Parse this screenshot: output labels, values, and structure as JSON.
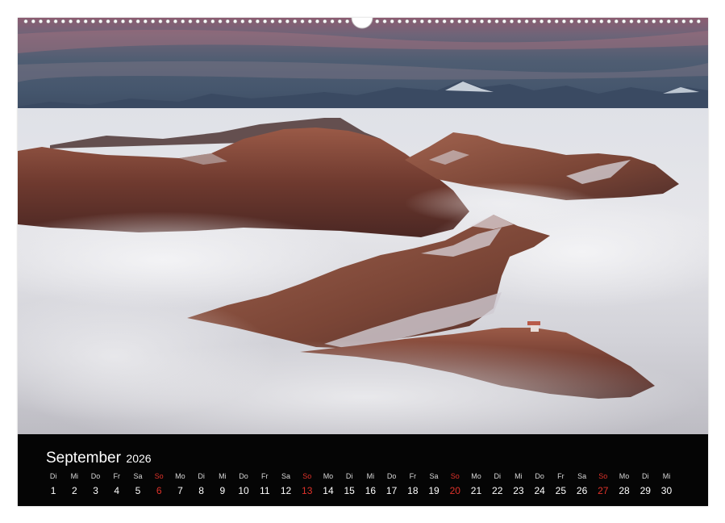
{
  "calendar": {
    "month": "September",
    "year": "2026",
    "weekend_color": "#e0322a",
    "days": [
      {
        "dow": "Di",
        "num": "1"
      },
      {
        "dow": "Mi",
        "num": "2"
      },
      {
        "dow": "Do",
        "num": "3"
      },
      {
        "dow": "Fr",
        "num": "4"
      },
      {
        "dow": "Sa",
        "num": "5"
      },
      {
        "dow": "So",
        "num": "6",
        "sunday": true
      },
      {
        "dow": "Mo",
        "num": "7"
      },
      {
        "dow": "Di",
        "num": "8"
      },
      {
        "dow": "Mi",
        "num": "9"
      },
      {
        "dow": "Do",
        "num": "10"
      },
      {
        "dow": "Fr",
        "num": "11"
      },
      {
        "dow": "Sa",
        "num": "12"
      },
      {
        "dow": "So",
        "num": "13",
        "sunday": true
      },
      {
        "dow": "Mo",
        "num": "14"
      },
      {
        "dow": "Di",
        "num": "15"
      },
      {
        "dow": "Mi",
        "num": "16"
      },
      {
        "dow": "Do",
        "num": "17"
      },
      {
        "dow": "Fr",
        "num": "18"
      },
      {
        "dow": "Sa",
        "num": "19"
      },
      {
        "dow": "So",
        "num": "20",
        "sunday": true
      },
      {
        "dow": "Mo",
        "num": "21"
      },
      {
        "dow": "Di",
        "num": "22"
      },
      {
        "dow": "Mi",
        "num": "23"
      },
      {
        "dow": "Do",
        "num": "24"
      },
      {
        "dow": "Fr",
        "num": "25"
      },
      {
        "dow": "Sa",
        "num": "26"
      },
      {
        "dow": "So",
        "num": "27",
        "sunday": true
      },
      {
        "dow": "Mo",
        "num": "28"
      },
      {
        "dow": "Di",
        "num": "29"
      },
      {
        "dow": "Mi",
        "num": "30"
      }
    ]
  }
}
